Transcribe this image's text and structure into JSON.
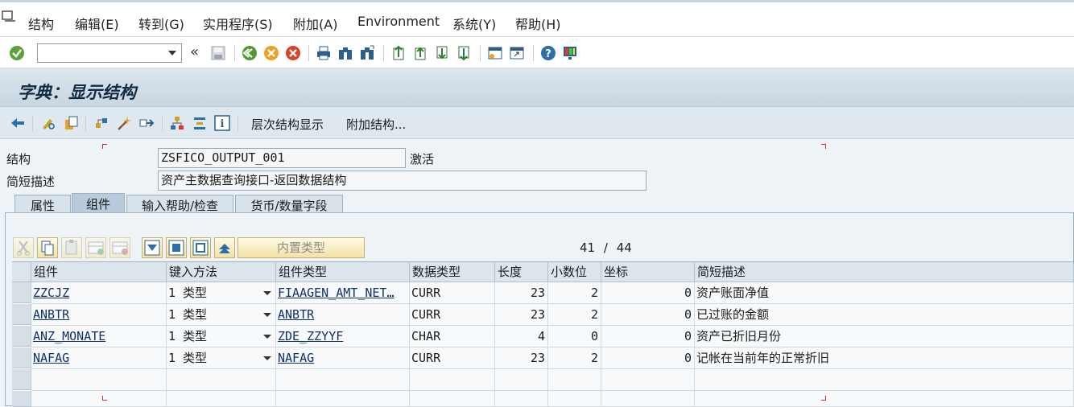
{
  "menu": [
    "结构",
    "编辑(E)",
    "转到(G)",
    "实用程序(S)",
    "附加(A)",
    "Environment",
    "系统(Y)",
    "帮助(H)"
  ],
  "std_toolbar": {
    "command_value": "",
    "icons": [
      "enter-icon",
      "back-icon",
      "save-icon",
      "back-green-icon",
      "exit-icon",
      "cancel-icon",
      "print-icon",
      "find-icon",
      "find-next-icon",
      "first-page-icon",
      "prev-page-icon",
      "next-page-icon",
      "last-page-icon",
      "new-session-icon",
      "shortcut-icon",
      "help-icon",
      "customize-layout-icon"
    ]
  },
  "title": "字典：显示结构",
  "app_toolbar": {
    "hierarchy_label": "层次结构显示",
    "append_label": "附加结构..."
  },
  "form": {
    "structure_label": "结构",
    "structure_value": "ZSFICO_OUTPUT_001",
    "status": "激活",
    "short_desc_label": "简短描述",
    "short_desc_value": "资产主数据查询接口-返回数据结构"
  },
  "tabs": [
    "属性",
    "组件",
    "输入帮助/检查",
    "货币/数量字段"
  ],
  "active_tab": 1,
  "table_toolbar": {
    "builtin_type_label": "内置类型",
    "position": "41",
    "separator": "/",
    "total": "44"
  },
  "columns": [
    "组件",
    "键入方法",
    "组件类型",
    "数据类型",
    "长度",
    "小数位",
    "坐标",
    "简短描述"
  ],
  "rows": [
    {
      "component": "ZZCJZ",
      "typing": "1 类型",
      "comp_type": "FIAAGEN_AMT_NET…",
      "data_type": "CURR",
      "length": "23",
      "decimals": "2",
      "coord": "0",
      "desc": "资产账面净值"
    },
    {
      "component": "ANBTR",
      "typing": "1 类型",
      "comp_type": "ANBTR",
      "data_type": "CURR",
      "length": "23",
      "decimals": "2",
      "coord": "0",
      "desc": "已过账的金额"
    },
    {
      "component": "ANZ_MONATE",
      "typing": "1 类型",
      "comp_type": "ZDE_ZZYYF",
      "data_type": "CHAR",
      "length": "4",
      "decimals": "0",
      "coord": "0",
      "desc": "资产已折旧月份"
    },
    {
      "component": "NAFAG",
      "typing": "1 类型",
      "comp_type": "NAFAG",
      "data_type": "CURR",
      "length": "23",
      "decimals": "2",
      "coord": "0",
      "desc": "记帐在当前年的正常折旧"
    }
  ]
}
